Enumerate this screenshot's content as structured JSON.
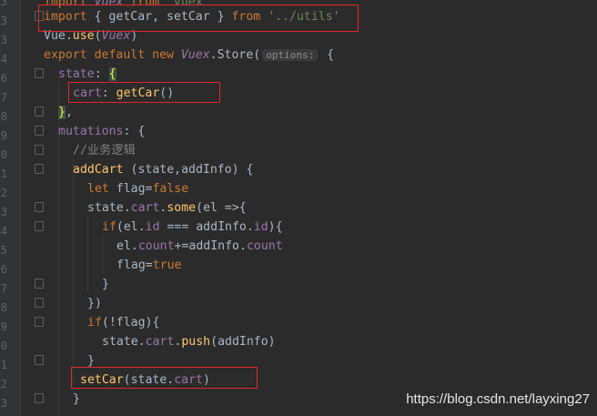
{
  "gutter": {
    "line_numbers": [
      "3",
      "3",
      "3",
      "4",
      "6",
      "7",
      "8",
      "9",
      "0",
      "1",
      "2",
      "3",
      "4",
      "5",
      "6",
      "7",
      "8",
      "9",
      "0",
      "1",
      "2",
      "3"
    ]
  },
  "code": {
    "line0": {
      "a": "import ",
      "b": "Vuex",
      "c": " from ",
      "d": "'vuex'"
    },
    "line1": {
      "a": "import",
      "b": " { ",
      "c": "getCar",
      "d": ", ",
      "e": "setCar",
      "f": " } ",
      "g": "from",
      "h": " ",
      "i": "'../utils'"
    },
    "line2": {
      "a": "Vue.",
      "b": "use",
      "c": "(",
      "d": "Vuex",
      "e": ")"
    },
    "line3": {
      "a": "export default new ",
      "b": "Vuex",
      "c": ".",
      "d": "Store",
      "e": "(",
      "f": "options:",
      "g": " {"
    },
    "line4": {
      "a": "state",
      "b": ": ",
      "c": "{"
    },
    "line5": {
      "a": "cart",
      "b": ": ",
      "c": "getCar",
      "d": "()"
    },
    "line6": {
      "a": "}",
      "b": ","
    },
    "line7": {
      "a": "mutations",
      "b": ": {"
    },
    "line8": {
      "a": "//业务逻辑"
    },
    "line9": {
      "a": "addCart",
      "b": " (state,addInfo) {"
    },
    "line10": {
      "a": "let ",
      "b": "flag",
      "c": "=",
      "d": "false"
    },
    "line11": {
      "a": "state.",
      "b": "cart",
      "c": ".",
      "d": "some",
      "e": "(el =>{"
    },
    "line12": {
      "a": "if",
      "b": "(el.",
      "c": "id",
      "d": " === addInfo.",
      "e": "id",
      "f": "){"
    },
    "line13": {
      "a": "el.",
      "b": "count",
      "c": "+=addInfo.",
      "d": "count"
    },
    "line14": {
      "a": "flag",
      "b": "=",
      "c": "true"
    },
    "line15": {
      "a": "}"
    },
    "line16": {
      "a": "})"
    },
    "line17": {
      "a": "if",
      "b": "(!",
      "c": "flag",
      "d": "){"
    },
    "line18": {
      "a": "state.",
      "b": "cart",
      "c": ".",
      "d": "push",
      "e": "(addInfo)"
    },
    "line19": {
      "a": "}"
    },
    "line20": {
      "a": "setCar",
      "b": "(state.",
      "c": "cart",
      "d": ")"
    },
    "line21": {
      "a": "}"
    }
  },
  "watermark": "https://blog.csdn.net/layxing27",
  "colors": {
    "background": "#2b2b2b",
    "keyword": "#cc7832",
    "function": "#ffc66d",
    "property": "#9876aa",
    "string": "#6a8759",
    "text": "#a9b7c6",
    "highlight_box": "#e0282a"
  }
}
